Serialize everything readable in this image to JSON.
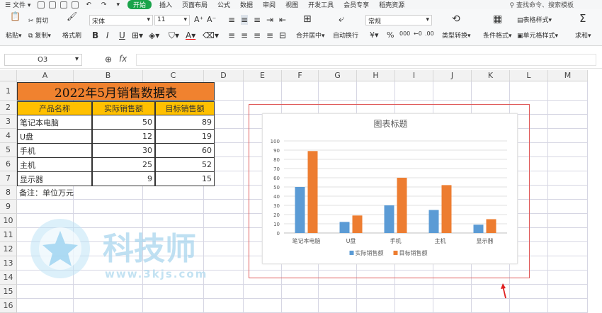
{
  "menu": {
    "file": "文件",
    "tabs": [
      "开始",
      "插入",
      "页面布局",
      "公式",
      "数据",
      "审阅",
      "视图",
      "开发工具",
      "会员专享",
      "稻壳资源"
    ],
    "search": "查找命令、搜索模板"
  },
  "ribbon": {
    "cut": "剪切",
    "paste": "粘贴",
    "copy": "复制",
    "format_painter": "格式刷",
    "font_name": "宋体",
    "font_size": "11",
    "merge_center": "合并居中",
    "wrap_text": "自动换行",
    "number_format": "常规",
    "type_convert": "类型转换",
    "cond_format": "条件格式",
    "table_style": "表格样式",
    "cell_style": "单元格样式",
    "sum": "求和"
  },
  "formula": {
    "cell_ref": "O3",
    "fx": "fx",
    "value": ""
  },
  "columns": [
    "A",
    "B",
    "C",
    "D",
    "E",
    "F",
    "G",
    "H",
    "I",
    "J",
    "K",
    "L",
    "M"
  ],
  "rows": [
    "1",
    "2",
    "3",
    "4",
    "5",
    "6",
    "7",
    "8",
    "9",
    "10",
    "11",
    "12",
    "13",
    "14",
    "15",
    "16"
  ],
  "sheet": {
    "title": "2022年5月销售数据表",
    "headers": [
      "产品名称",
      "实际销售额",
      "目标销售额"
    ],
    "data": [
      {
        "name": "笔记本电脑",
        "actual": "50",
        "target": "89"
      },
      {
        "name": "U盘",
        "actual": "12",
        "target": "19"
      },
      {
        "name": "手机",
        "actual": "30",
        "target": "60"
      },
      {
        "name": "主机",
        "actual": "25",
        "target": "52"
      },
      {
        "name": "显示器",
        "actual": "9",
        "target": "15"
      }
    ],
    "note": "备注：单位万元"
  },
  "chart_data": {
    "type": "bar",
    "title": "图表标题",
    "categories": [
      "笔记本电脑",
      "U盘",
      "手机",
      "主机",
      "显示器"
    ],
    "series": [
      {
        "name": "实际销售额",
        "values": [
          50,
          12,
          30,
          25,
          9
        ],
        "color": "#5b9bd5"
      },
      {
        "name": "目标销售额",
        "values": [
          89,
          19,
          60,
          52,
          15
        ],
        "color": "#ed7d31"
      }
    ],
    "ylim": [
      0,
      100
    ],
    "yticks": [
      0,
      10,
      20,
      30,
      40,
      50,
      60,
      70,
      80,
      90,
      100
    ],
    "grid": true,
    "legend": "bottom"
  },
  "watermark": {
    "brand": "科技师",
    "url": "www.3kjs.com"
  }
}
